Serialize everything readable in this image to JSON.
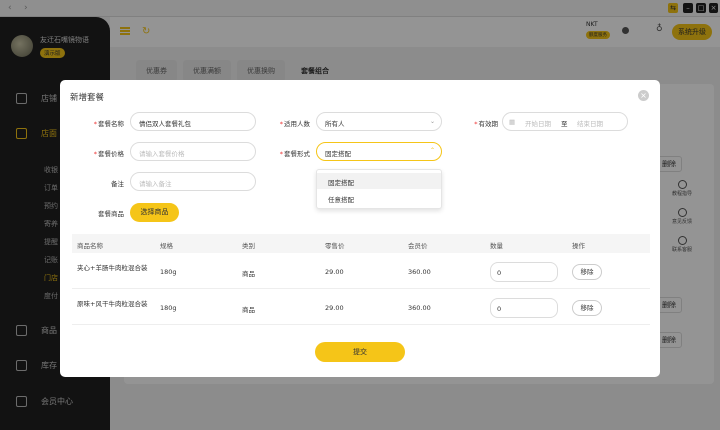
{
  "sidebar": {
    "shop_name": "友迁石嘴镜物语",
    "badge": "演示版",
    "items": [
      {
        "label": "店铺"
      },
      {
        "label": "店面"
      },
      {
        "label": "商品"
      },
      {
        "label": "库存"
      },
      {
        "label": "会员中心"
      }
    ],
    "sub_items": [
      "收银",
      "订单",
      "预约",
      "寄养",
      "提醒",
      "记账",
      "门店",
      "度付"
    ]
  },
  "topbar": {
    "user": "NKT",
    "user_badge": "额度服务",
    "upgrade": "系统升级"
  },
  "bg_tabs": [
    "优惠券",
    "优惠满额",
    "优惠换购",
    "套餐组合"
  ],
  "bg_right": {
    "delete1": "删除",
    "delete2": "删除",
    "delete3": "删除",
    "help1": "教程指导",
    "help2": "意见反馈",
    "help3": "联系客服"
  },
  "modal": {
    "title": "新增套餐",
    "fields": {
      "name_label": "套餐名称",
      "name_value": "情侣双人套餐礼包",
      "people_label": "适用人数",
      "people_value": "所有人",
      "valid_label": "有效期",
      "start_placeholder": "开始日期",
      "to": "至",
      "end_placeholder": "结束日期",
      "price_label": "套餐价格",
      "price_placeholder": "请输入套餐价格",
      "form_label": "套餐形式",
      "form_value": "固定搭配",
      "remark_label": "备注",
      "remark_placeholder": "请输入备注",
      "goods_label": "套餐商品",
      "select_goods": "选择商品"
    },
    "dropdown_options": [
      "固定搭配",
      "任意搭配"
    ],
    "table": {
      "headers": [
        "商品名称",
        "规格",
        "类别",
        "零售价",
        "会员价",
        "数量",
        "操作"
      ],
      "rows": [
        {
          "name": "夹心+羊肠牛肉粒混合装",
          "spec": "180g",
          "category": "商品",
          "retail": "29.00",
          "member": "360.00",
          "qty": "0",
          "action": "移除"
        },
        {
          "name": "原味+风干牛肉粒混合装",
          "spec": "180g",
          "category": "商品",
          "retail": "29.00",
          "member": "360.00",
          "qty": "0",
          "action": "移除"
        }
      ]
    },
    "submit": "提交"
  },
  "colors": {
    "accent": "#f5c518",
    "sidebar_bg": "#1f1f1f",
    "required": "#e33333"
  }
}
